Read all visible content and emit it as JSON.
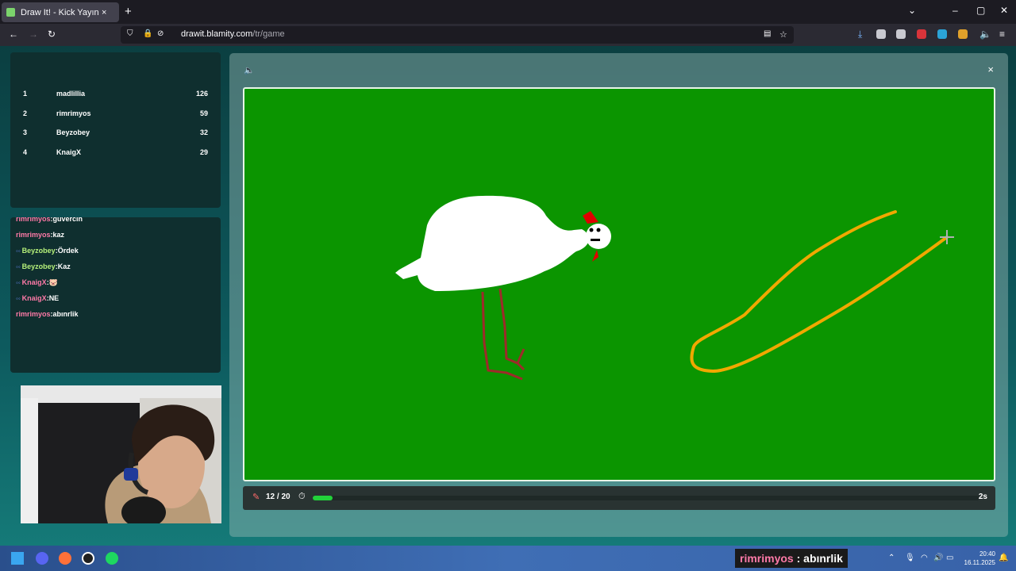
{
  "browser": {
    "tab_title": "Draw It! - Kick Yayınla",
    "tab_close": "×",
    "new_tab": "+",
    "url_domain": "drawit.blamity.com",
    "url_path": "/tr/game"
  },
  "leaderboard": [
    {
      "rank": "1",
      "name": "madlillia",
      "score": "126"
    },
    {
      "rank": "2",
      "name": "rimrimyos",
      "score": "59"
    },
    {
      "rank": "3",
      "name": "Beyzobey",
      "score": "32"
    },
    {
      "rank": "4",
      "name": "KnaigX",
      "score": "29"
    }
  ],
  "chat": [
    {
      "user": "rimrimyos",
      "text": "guvercin",
      "color": "#ff7aa8",
      "badge": false
    },
    {
      "user": "rimrimyos",
      "text": "kaz",
      "color": "#ff7aa8",
      "badge": false
    },
    {
      "user": "Beyzobey",
      "text": "Ördek",
      "color": "#b6f07a",
      "badge": true
    },
    {
      "user": "Beyzobey",
      "text": "Kaz",
      "color": "#b6f07a",
      "badge": true
    },
    {
      "user": "KnaigX",
      "text": "🐷",
      "color": "#ff7aa8",
      "badge": true
    },
    {
      "user": "KnaigX",
      "text": "NE",
      "color": "#ff7aa8",
      "badge": true
    },
    {
      "user": "rimrimyos",
      "text": "abınrlik",
      "color": "#ff7aa8",
      "badge": false
    }
  ],
  "game": {
    "round_label": "12 / 20",
    "time_left": "2s",
    "progress_fraction": 0.03,
    "canvas_color": "#0b9500",
    "close_label": "×"
  },
  "overlay": {
    "user": "rimrimyos",
    "sep": " : ",
    "message": "abınrlik"
  },
  "clock": {
    "time": "20:40",
    "date": "16.11.2025"
  },
  "icons": [
    "pencil-icon",
    "timer-icon",
    "speaker-icon",
    "close-icon",
    "windows-start-icon"
  ]
}
